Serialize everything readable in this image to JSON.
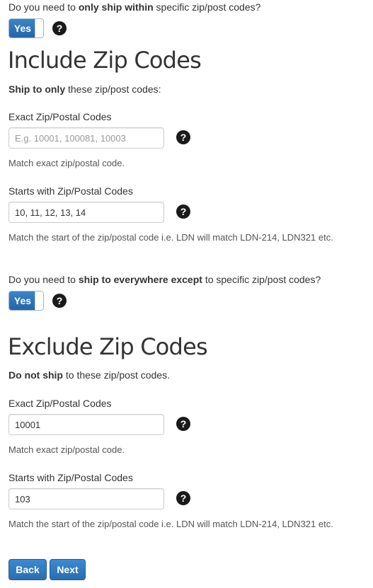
{
  "include": {
    "question": {
      "prefix": "Do you need to ",
      "bold": "only ship within",
      "suffix": " specific zip/post codes?"
    },
    "toggle_label": "Yes",
    "help_icon": "question-circle-icon",
    "heading": "Include Zip Codes",
    "intro": {
      "bold": "Ship to only",
      "rest": " these zip/post codes:"
    },
    "exact": {
      "label": "Exact Zip/Postal Codes",
      "placeholder": "E.g. 10001, 100081, 10003",
      "value": "",
      "hint": "Match exact zip/postal code."
    },
    "starts": {
      "label": "Starts with Zip/Postal Codes",
      "value": "10, 11, 12, 13, 14",
      "hint": "Match the start of the zip/postal code i.e. LDN will match LDN-214, LDN321 etc."
    }
  },
  "exclude": {
    "question": {
      "prefix": "Do you need to ",
      "bold": "ship to everywhere except",
      "suffix": " to specific zip/post codes?"
    },
    "toggle_label": "Yes",
    "heading": "Exclude Zip Codes",
    "intro": {
      "bold": "Do not ship",
      "rest": " to these zip/post codes."
    },
    "exact": {
      "label": "Exact Zip/Postal Codes",
      "value": "10001",
      "hint": "Match exact zip/postal code."
    },
    "starts": {
      "label": "Starts with Zip/Postal Codes",
      "value": "103",
      "hint": "Match the start of the zip/postal code i.e. LDN will match LDN-214, LDN321 etc."
    }
  },
  "help_glyph": "?",
  "buttons": {
    "back": "Back",
    "next": "Next"
  },
  "colors": {
    "primary": "#2a6db0",
    "text": "#333333",
    "help_icon": "#1a1a1a"
  }
}
